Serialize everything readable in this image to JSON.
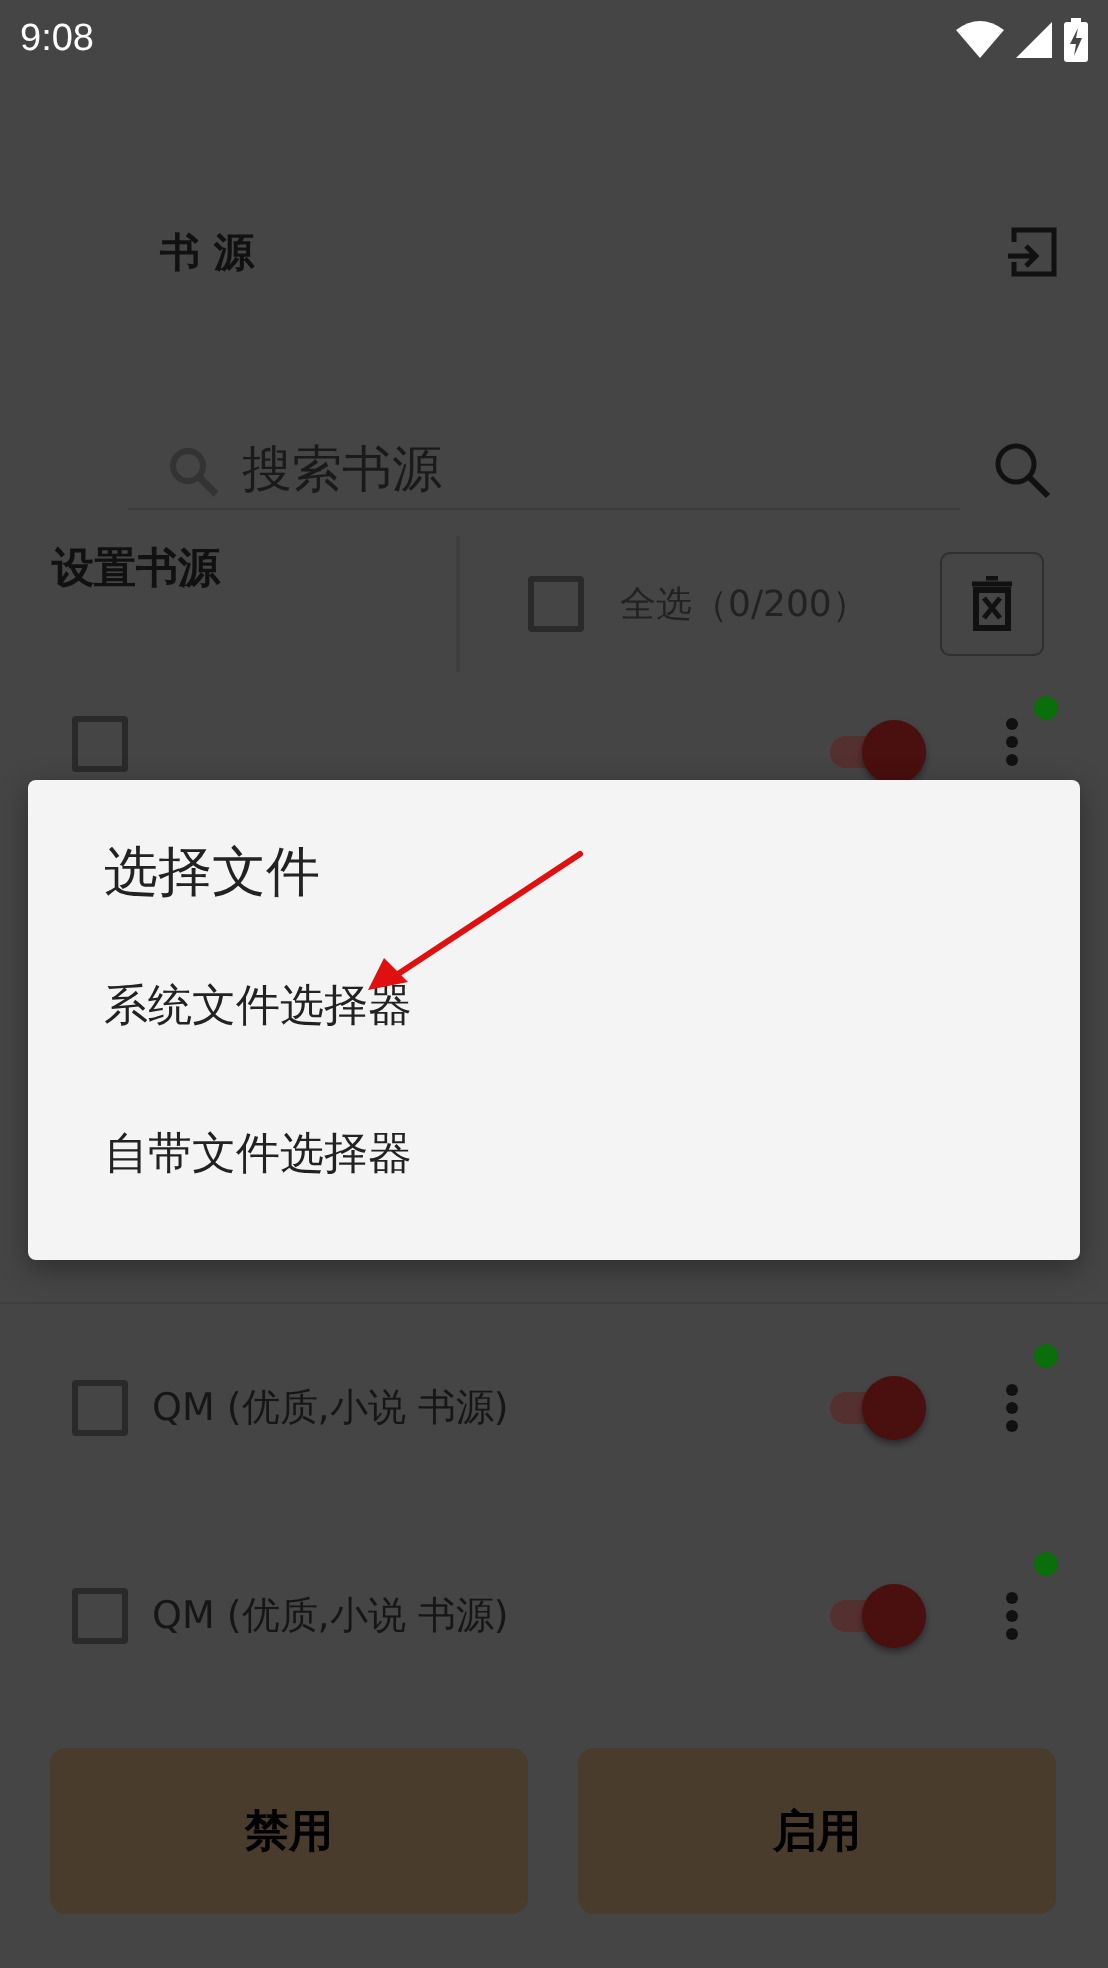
{
  "status_bar": {
    "time": "9:08"
  },
  "toolbar": {
    "title": "书 源"
  },
  "search": {
    "placeholder": "搜索书源"
  },
  "section": {
    "title": "设置书源",
    "select_all": {
      "label": "全选（0/200）",
      "checked": false
    }
  },
  "sources": [
    {
      "kind": "covered",
      "checked": false,
      "on": true,
      "color": "#0a6e0a"
    },
    {
      "kind": "full",
      "name": "QM (优质,小说 书源)",
      "checked": false,
      "on": true,
      "color": "#0a6e0a"
    },
    {
      "kind": "full",
      "name": "QM (优质,小说 书源)",
      "checked": false,
      "on": true,
      "color": "#0a6e0a"
    }
  ],
  "buttons": [
    "禁用",
    "启用"
  ],
  "dialog": {
    "title": "选择文件",
    "options": [
      "系统文件选择器",
      "自带文件选择器"
    ]
  }
}
